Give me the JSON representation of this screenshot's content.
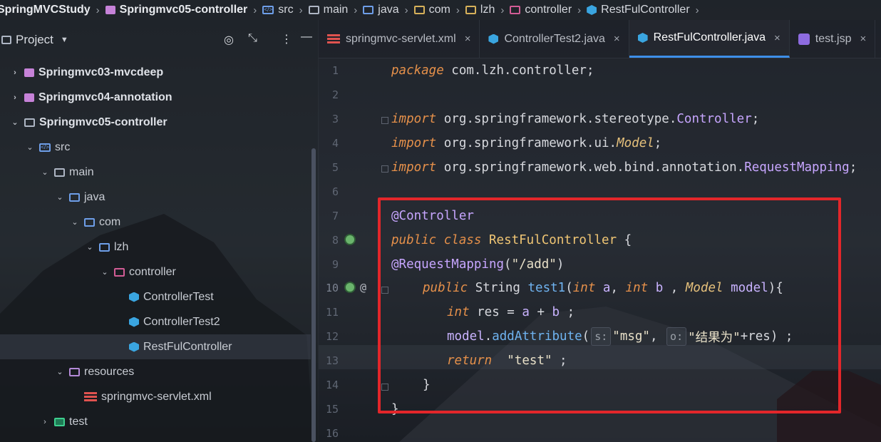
{
  "breadcrumb": [
    {
      "label": "SpringMVCStudy",
      "icon": "none",
      "bold": true
    },
    {
      "label": "Springmvc05-controller",
      "icon": "module-icon",
      "bold": true
    },
    {
      "label": "src",
      "icon": "source-folder-icon",
      "bold": false
    },
    {
      "label": "main",
      "icon": "folder-icon",
      "bold": false
    },
    {
      "label": "java",
      "icon": "folder-icon",
      "bold": false
    },
    {
      "label": "com",
      "icon": "package-icon",
      "bold": false
    },
    {
      "label": "lzh",
      "icon": "package-icon",
      "bold": false
    },
    {
      "label": "controller",
      "icon": "controller-package-icon",
      "bold": false
    },
    {
      "label": "RestFulController",
      "icon": "class-icon",
      "bold": false
    }
  ],
  "project_panel": {
    "title": "Project",
    "tools": [
      "target-icon",
      "collapse-icon",
      "more-icon",
      "minimize-icon"
    ],
    "tree": [
      {
        "label": "Springmvc03-mvcdeep",
        "depth": 1,
        "arrow": "›",
        "icon": "module",
        "bold": true
      },
      {
        "label": "Springmvc04-annotation",
        "depth": 1,
        "arrow": "›",
        "icon": "module",
        "bold": true
      },
      {
        "label": "Springmvc05-controller",
        "depth": 1,
        "arrow": "⌄",
        "icon": "folder",
        "bold": true
      },
      {
        "label": "src",
        "depth": 2,
        "arrow": "⌄",
        "icon": "src",
        "bold": false
      },
      {
        "label": "main",
        "depth": 3,
        "arrow": "⌄",
        "icon": "folder",
        "bold": false
      },
      {
        "label": "java",
        "depth": 4,
        "arrow": "⌄",
        "icon": "folder-blue",
        "bold": false
      },
      {
        "label": "com",
        "depth": 5,
        "arrow": "⌄",
        "icon": "folder-blue",
        "bold": false
      },
      {
        "label": "lzh",
        "depth": 6,
        "arrow": "⌄",
        "icon": "folder-blue",
        "bold": false
      },
      {
        "label": "controller",
        "depth": 7,
        "arrow": "⌄",
        "icon": "pkg",
        "bold": false
      },
      {
        "label": "ControllerTest",
        "depth": 8,
        "arrow": "",
        "icon": "class",
        "bold": false
      },
      {
        "label": "ControllerTest2",
        "depth": 8,
        "arrow": "",
        "icon": "class",
        "bold": false
      },
      {
        "label": "RestFulController",
        "depth": 8,
        "arrow": "",
        "icon": "class",
        "bold": false,
        "selected": true
      },
      {
        "label": "resources",
        "depth": 4,
        "arrow": "⌄",
        "icon": "resources",
        "bold": false
      },
      {
        "label": "springmvc-servlet.xml",
        "depth": 5,
        "arrow": "",
        "icon": "xml",
        "bold": false
      },
      {
        "label": "test",
        "depth": 3,
        "arrow": "›",
        "icon": "test-folder",
        "bold": false
      }
    ]
  },
  "tabs": [
    {
      "label": "springmvc-servlet.xml",
      "icon": "xml-icon",
      "active": false
    },
    {
      "label": "ControllerTest2.java",
      "icon": "class-icon",
      "active": false
    },
    {
      "label": "RestFulController.java",
      "icon": "class-icon",
      "active": true
    },
    {
      "label": "test.jsp",
      "icon": "jsp-icon",
      "active": false
    }
  ],
  "close_glyph": "×",
  "line_numbers": [
    "1",
    "2",
    "3",
    "4",
    "5",
    "6",
    "7",
    "8",
    "9",
    "10",
    "11",
    "12",
    "13",
    "14",
    "15",
    "16"
  ],
  "code": {
    "l1": [
      "package",
      " com.lzh.controller;"
    ],
    "l3": [
      "import",
      " org.springframework.stereotype.",
      "Controller",
      ";"
    ],
    "l4": [
      "import",
      " org.springframework.ui.",
      "Model",
      ";"
    ],
    "l5": [
      "import",
      " org.springframework.web.bind.annotation.",
      "RequestMapping",
      ";"
    ],
    "l7": [
      "@Controller"
    ],
    "l8": [
      "public",
      " ",
      "class",
      " ",
      "RestFulController",
      " {"
    ],
    "l9": [
      "@RequestMapping",
      "(",
      "\"/add\"",
      ")"
    ],
    "l10": [
      "public",
      " String ",
      "test1",
      "(",
      "int",
      " ",
      "a",
      ", ",
      "int",
      " ",
      "b",
      " , ",
      "Model",
      " ",
      "model",
      "){"
    ],
    "l11": [
      "int",
      " res = ",
      "a",
      " + ",
      "b",
      " ;"
    ],
    "l12": [
      "model",
      ".",
      "addAttribute",
      "(",
      "s:",
      "\"msg\"",
      ", ",
      "o:",
      "\"结果为\"",
      "+res) ;"
    ],
    "l13": [
      "return",
      "  ",
      "\"test\"",
      " ;"
    ],
    "l14": [
      "}"
    ],
    "l15": [
      "}"
    ]
  },
  "colors": {
    "highlight_box": "#e3262a",
    "active_tab_underline": "#3d8fe8",
    "keyword": "#e5904a",
    "annotation": "#c7a6ff"
  }
}
